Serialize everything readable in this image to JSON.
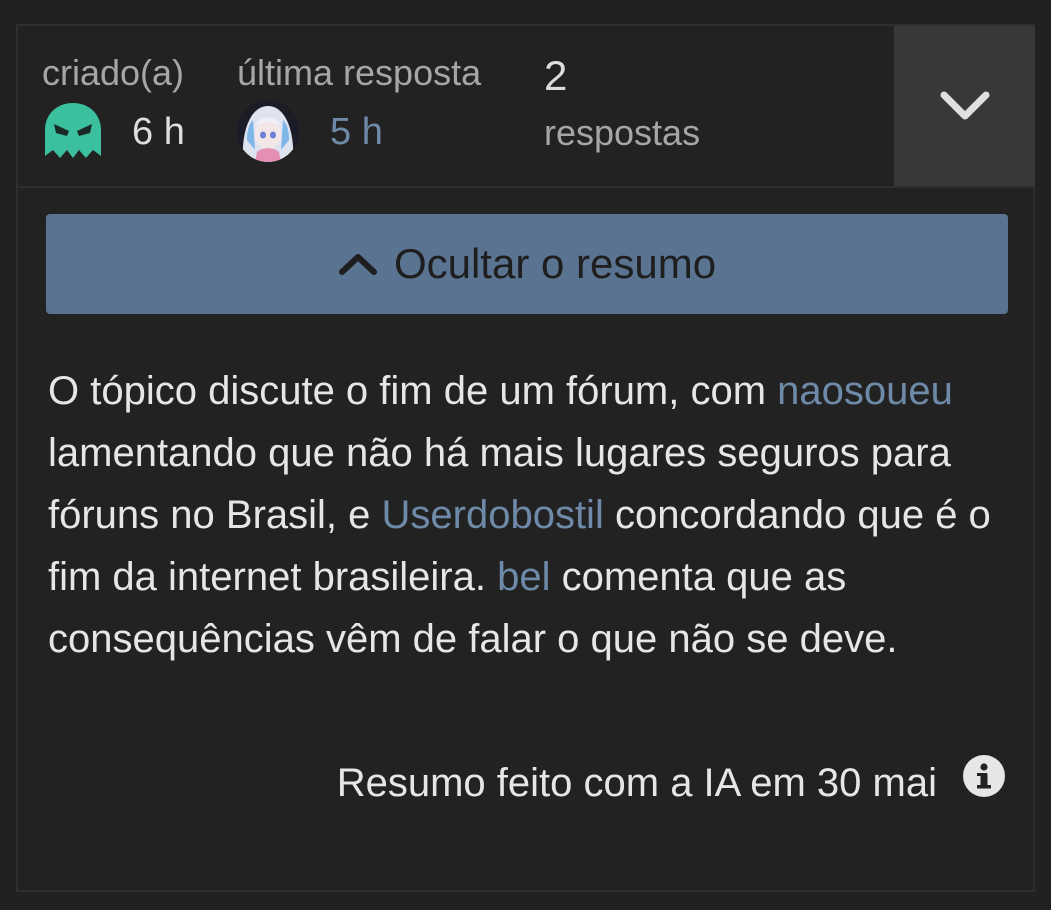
{
  "topic_map": {
    "created": {
      "label": "criado(a)",
      "time": "6 h",
      "avatar_icon": "ghost-avatar-icon",
      "avatar_color": "#3bbf9e"
    },
    "last_reply": {
      "label": "última resposta",
      "time": "5 h",
      "avatar_icon": "anime-girl-avatar",
      "time_color": "#6e8aa8"
    },
    "replies": {
      "count": "2",
      "label": "respostas"
    },
    "expand_icon": "chevron-down-icon"
  },
  "summary": {
    "toggle_label": "Ocultar o resumo",
    "toggle_icon": "chevron-up-icon",
    "toggle_color": "#5a7390",
    "text": {
      "part1": "O tópico discute o fim de um fórum, com ",
      "mention1": "naosoueu",
      "part2": " lamentando que não há mais lugares seguros para fóruns no Brasil, e ",
      "mention2": "Userdobostil",
      "part3": " concordando que é o fim da internet brasileira. ",
      "mention3": "bel",
      "part4": " comenta que as consequências vêm de falar o que não se deve."
    },
    "footer_note": "Resumo feito com a IA em 30 mai",
    "info_icon": "info-icon",
    "mention_color": "#6e8aa8"
  }
}
